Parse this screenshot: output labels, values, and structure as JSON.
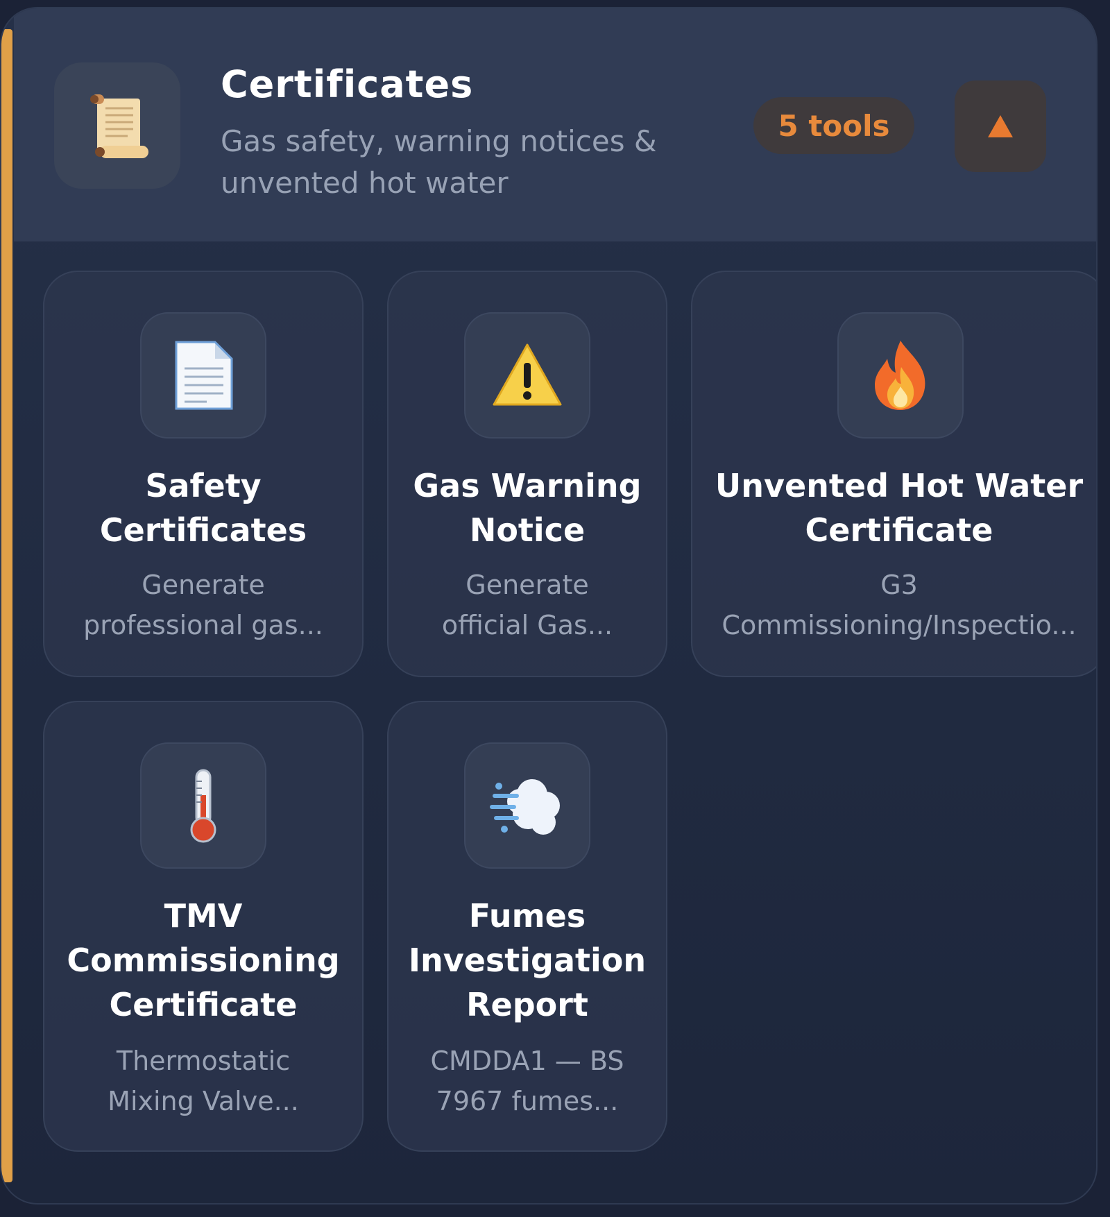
{
  "header": {
    "title": "Certificates",
    "subtitle": "Gas safety, warning notices & unvented hot water",
    "tools_badge": "5 tools",
    "icon": "scroll-icon",
    "collapse_icon": "triangle-up-icon"
  },
  "colors": {
    "accent": "#e0a048",
    "badge_text": "#e88a3c",
    "panel_bg": "#253048",
    "header_bg": "#313c55"
  },
  "tools": [
    {
      "title": "Safety Certificates",
      "description_line1": "Generate",
      "description_line2": "professional gas...",
      "icon": "document-icon"
    },
    {
      "title": "Gas Warning Notice",
      "description_line1": "Generate",
      "description_line2": "official Gas...",
      "icon": "warning-icon"
    },
    {
      "title": "Unvented Hot Water Certificate",
      "description_line1": "G3",
      "description_line2": "Commissioning/Inspectio...",
      "icon": "fire-icon"
    },
    {
      "title": "TMV Commissioning Certificate",
      "description_line1": "Thermostatic",
      "description_line2": "Mixing Valve...",
      "icon": "thermometer-icon"
    },
    {
      "title": "Fumes Investigation Report",
      "description_line1": "CMDDA1 — BS",
      "description_line2": "7967 fumes...",
      "icon": "wind-cloud-icon"
    }
  ]
}
